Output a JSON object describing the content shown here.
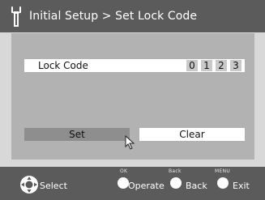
{
  "header": {
    "title": "Initial Setup > Set Lock Code",
    "icon": "wrench-icon"
  },
  "lock_code": {
    "label": "Lock Code",
    "digits": [
      "0",
      "1",
      "2",
      "3"
    ]
  },
  "buttons": {
    "set_label": "Set",
    "clear_label": "Clear",
    "focused": "set"
  },
  "footer": {
    "select_label": "Select",
    "operate_key": "OK",
    "operate_label": "Operate",
    "back_key": "Back",
    "back_label": "Back",
    "exit_key": "MENU",
    "exit_label": "Exit"
  },
  "colors": {
    "title_bar": "#5b5b5b",
    "panel": "#b2b2b2",
    "focused_button": "#8e8e8e",
    "background": "#d8d8d8"
  }
}
